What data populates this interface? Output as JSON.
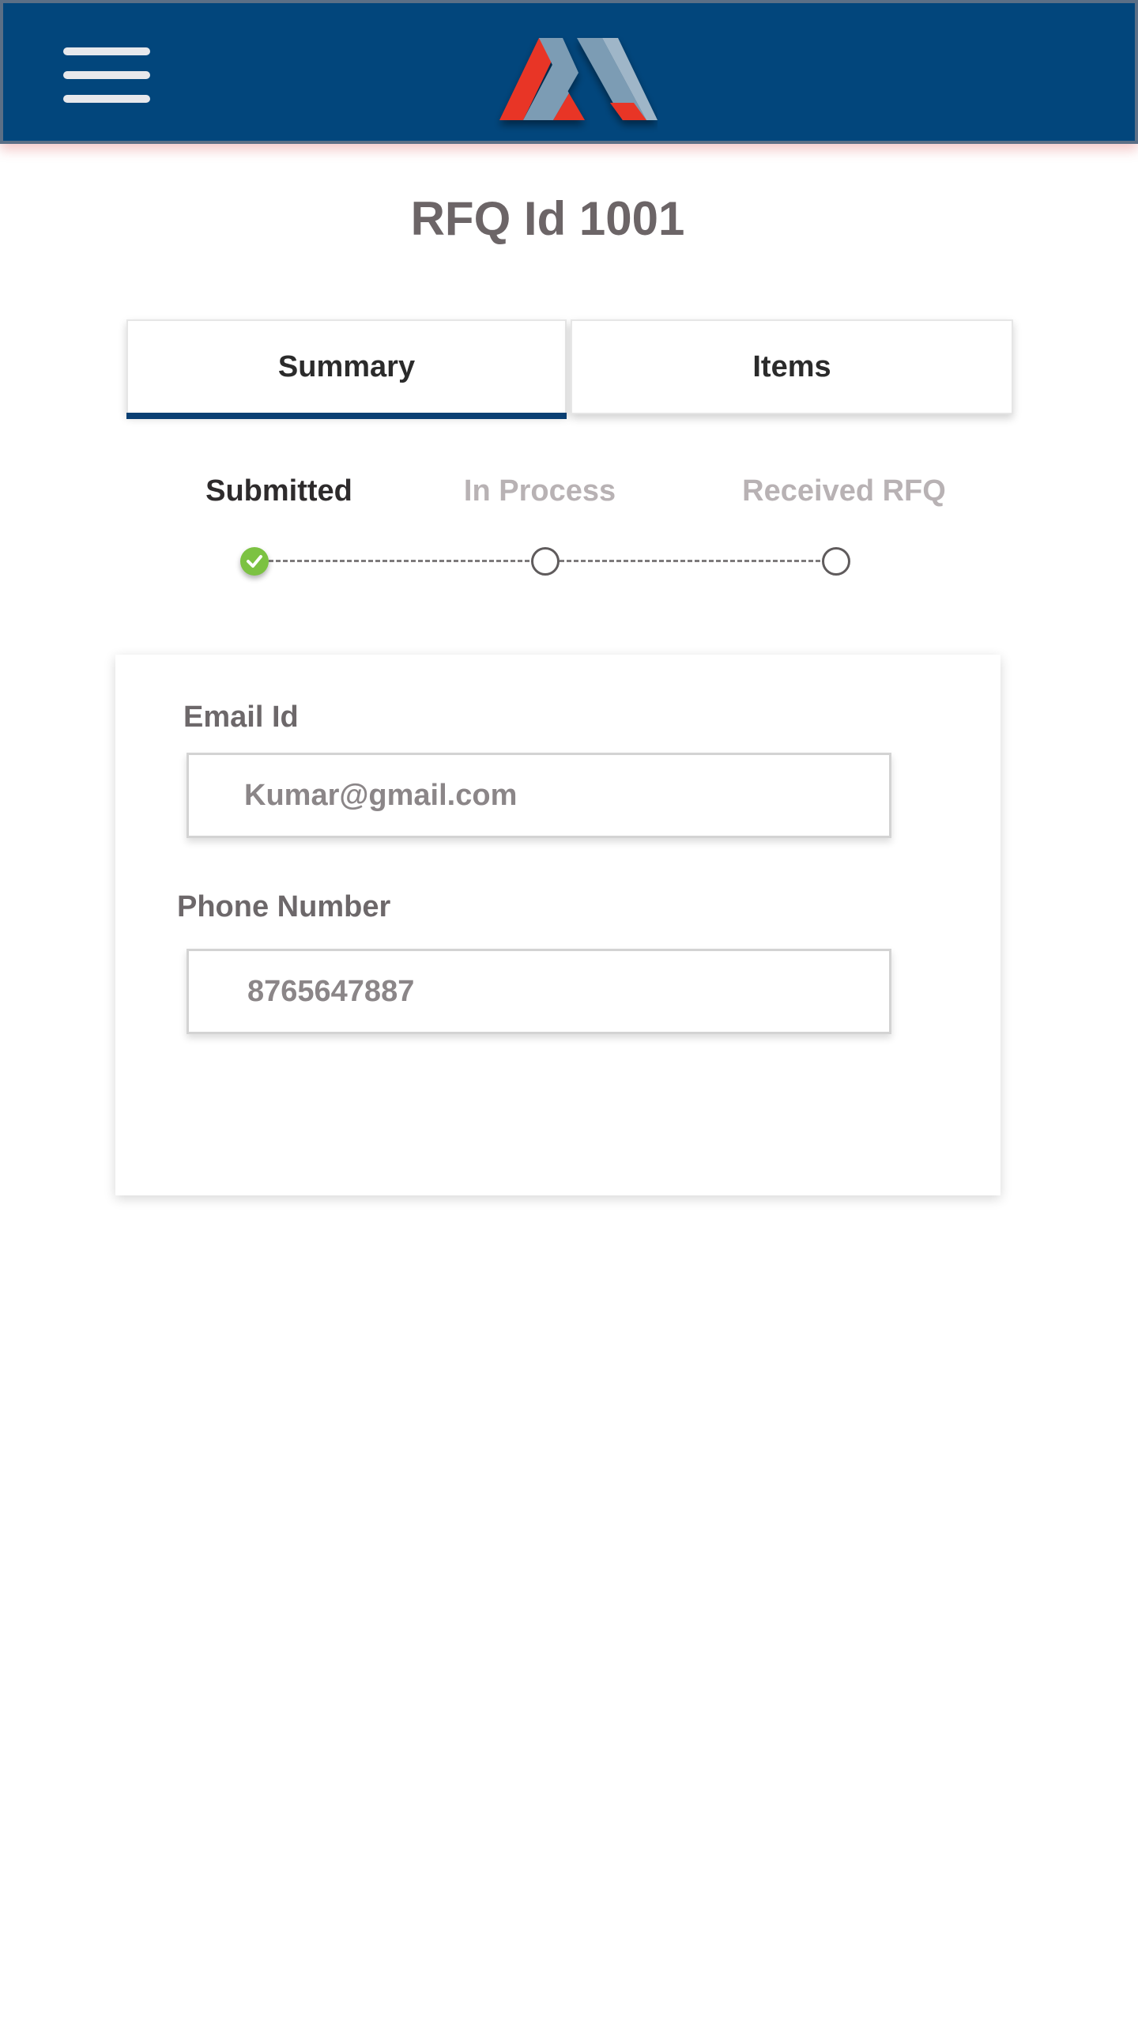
{
  "header": {
    "menu_icon": "hamburger-menu-icon",
    "logo": "brand-logo",
    "colors": {
      "bar": "#02467c",
      "logo_red": "#e83426",
      "logo_blue": "#7c9cb4"
    }
  },
  "page": {
    "title": "RFQ Id 1001"
  },
  "tabs": [
    {
      "label": "Summary",
      "active": true
    },
    {
      "label": "Items",
      "active": false
    }
  ],
  "status_steps": [
    {
      "label": "Submitted",
      "state": "completed",
      "icon": "check-icon"
    },
    {
      "label": "In Process",
      "state": "pending"
    },
    {
      "label": "Received RFQ",
      "state": "pending"
    }
  ],
  "form": {
    "email": {
      "label": "Email Id",
      "value": "Kumar@gmail.com"
    },
    "phone": {
      "label": "Phone Number",
      "value": "8765647887"
    }
  },
  "colors": {
    "accent": "#0a3f73",
    "step_done": "#7cc242"
  }
}
